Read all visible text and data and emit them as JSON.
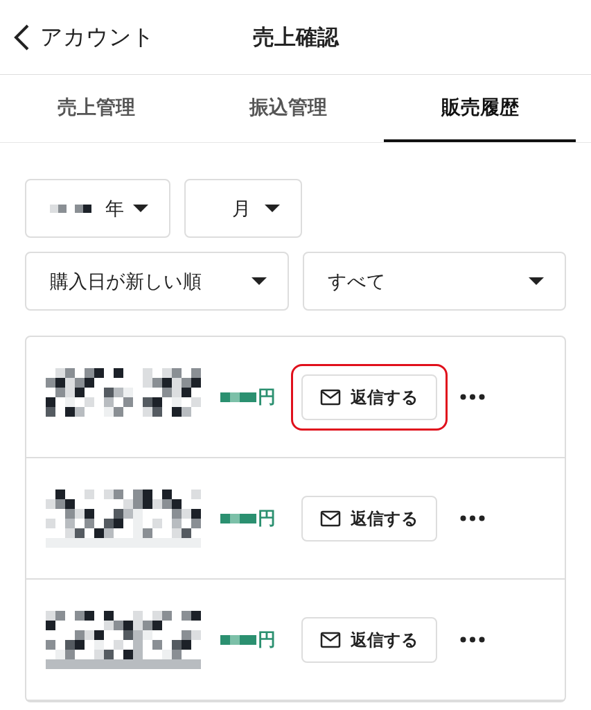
{
  "header": {
    "back_label": "アカウント",
    "title": "売上確認"
  },
  "tabs": [
    {
      "label": "売上管理",
      "selected": false
    },
    {
      "label": "振込管理",
      "selected": false
    },
    {
      "label": "販売履歴",
      "selected": true
    }
  ],
  "filters": {
    "year": "年",
    "month": "月",
    "sort": "購入日が新しい順",
    "status": "すべて"
  },
  "rows": [
    {
      "currency": "円",
      "reply_label": "返信する",
      "highlighted": true
    },
    {
      "currency": "円",
      "reply_label": "返信する",
      "highlighted": false
    },
    {
      "currency": "円",
      "reply_label": "返信する",
      "highlighted": false
    }
  ]
}
